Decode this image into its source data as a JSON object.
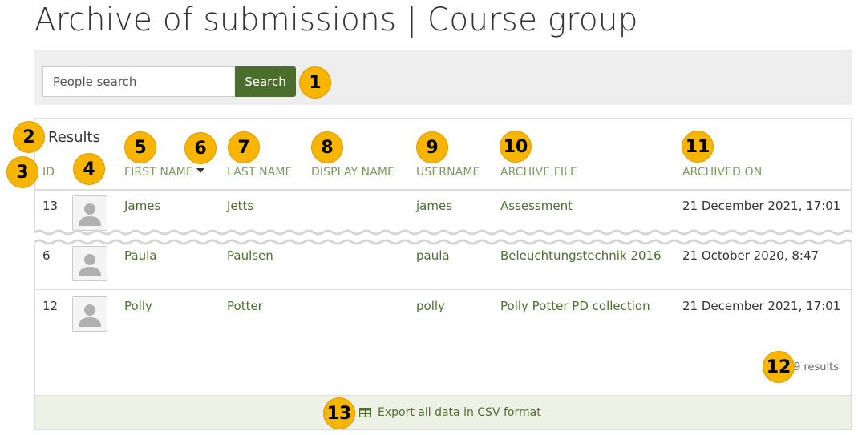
{
  "page": {
    "title": "Archive of submissions | Course group"
  },
  "search": {
    "placeholder": "People search",
    "button_label": "Search"
  },
  "results": {
    "title": "Results",
    "columns": {
      "id": "ID",
      "first_name": "First name",
      "last_name": "Last name",
      "display_name": "Display name",
      "username": "Username",
      "archive_file": "Archive file",
      "archived_on": "Archived on"
    },
    "rows": [
      {
        "id": "13",
        "first_name": "James",
        "last_name": "Jetts",
        "display_name": "",
        "username": "james",
        "archive_file": "Assessment",
        "archived_on": "21 December 2021, 17:01"
      },
      {
        "id": "6",
        "first_name": "Paula",
        "last_name": "Paulsen",
        "display_name": "",
        "username": "paula",
        "archive_file": "Beleuchtungstechnik 2016",
        "archived_on": "21 October 2020, 8:47"
      },
      {
        "id": "12",
        "first_name": "Polly",
        "last_name": "Potter",
        "display_name": "",
        "username": "polly",
        "archive_file": "Polly Potter PD collection",
        "archived_on": "21 December 2021, 17:01"
      }
    ],
    "count_text": "9 results",
    "export_label": "Export all data in CSV format"
  },
  "callouts": [
    "1",
    "2",
    "3",
    "4",
    "5",
    "6",
    "7",
    "8",
    "9",
    "10",
    "11",
    "12",
    "13"
  ],
  "colors": {
    "accent": "#4c6e2d",
    "badge": "#f7b500",
    "header_link": "#7a9a5a",
    "export_bg": "#eef2e6"
  },
  "icons": {
    "sort": "caret-down-icon",
    "export": "table-icon",
    "avatar": "default-user-avatar-icon"
  }
}
